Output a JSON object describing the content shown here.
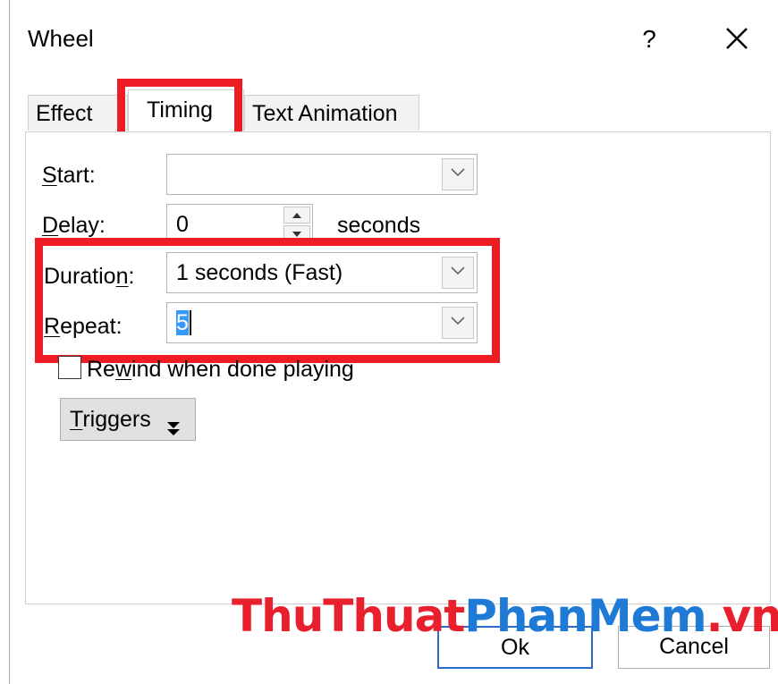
{
  "dialog": {
    "title": "Wheel",
    "help_label": "?"
  },
  "tabs": [
    {
      "label": "Effect"
    },
    {
      "label": "Timing"
    },
    {
      "label": "Text Animation"
    }
  ],
  "fields": {
    "start": {
      "label_pre": "",
      "label_key": "S",
      "label_post": "tart:",
      "value": ""
    },
    "delay": {
      "label_pre": "",
      "label_key": "D",
      "label_post": "elay:",
      "value": "0",
      "unit": "seconds"
    },
    "duration": {
      "label_pre": "Duratio",
      "label_key": "n",
      "label_post": ":",
      "value": "1 seconds (Fast)"
    },
    "repeat": {
      "label_pre": "",
      "label_key": "R",
      "label_post": "epeat:",
      "value": "5"
    }
  },
  "rewind": {
    "label_pre": "Re",
    "label_key": "w",
    "label_post": "ind when done playing",
    "checked": false
  },
  "triggers": {
    "label_pre": "",
    "label_key": "T",
    "label_post": "riggers"
  },
  "footer": {
    "ok_label": "Ok",
    "cancel_label": "Cancel"
  },
  "watermark": {
    "part1": "ThuThuat",
    "part2": "PhanMem",
    "part3": ".vn"
  },
  "colors": {
    "highlight": "#ee1c25",
    "accent": "#2a6cc7",
    "watermark_red": "#e8202e",
    "watermark_blue": "#1f7ad6"
  }
}
